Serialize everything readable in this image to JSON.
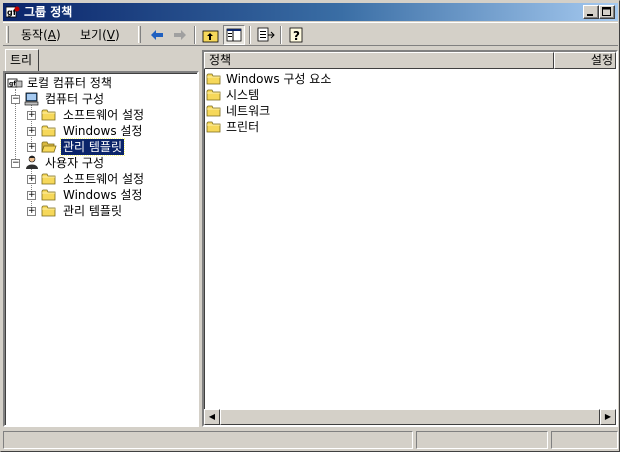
{
  "window": {
    "title": "그룹 정책",
    "buttons": [
      "minimize",
      "maximize"
    ]
  },
  "menu": [
    {
      "label": "동작(",
      "accel": "A",
      "tail": ")"
    },
    {
      "label": "보기(",
      "accel": "V",
      "tail": ")"
    }
  ],
  "toolbar": {
    "icons": [
      "back-arrow-icon",
      "forward-arrow-icon",
      "up-folder-icon",
      "show-hide-tree-icon",
      "export-list-icon",
      "help-icon"
    ],
    "show_hide_tree_pressed": true
  },
  "tree": {
    "tab_label": "트리",
    "root": "로컬 컴퓨터 정책",
    "computer": {
      "label": "컴퓨터 구성",
      "children": [
        "소프트웨어 설정",
        "Windows 설정",
        "관리 템플릿"
      ],
      "selected_index": 2
    },
    "user": {
      "label": "사용자 구성",
      "children": [
        "소프트웨어 설정",
        "Windows 설정",
        "관리 템플릿"
      ]
    }
  },
  "list": {
    "columns": [
      "정책",
      "설정"
    ],
    "items": [
      "Windows 구성 요소",
      "시스템",
      "네트워크",
      "프린터"
    ]
  },
  "colors": {
    "chrome": "#d4d0c8",
    "title_bar_start": "#0a246a",
    "title_bar_end": "#a6caf0",
    "selection": "#0a246a",
    "folder": "#f6d85a"
  }
}
